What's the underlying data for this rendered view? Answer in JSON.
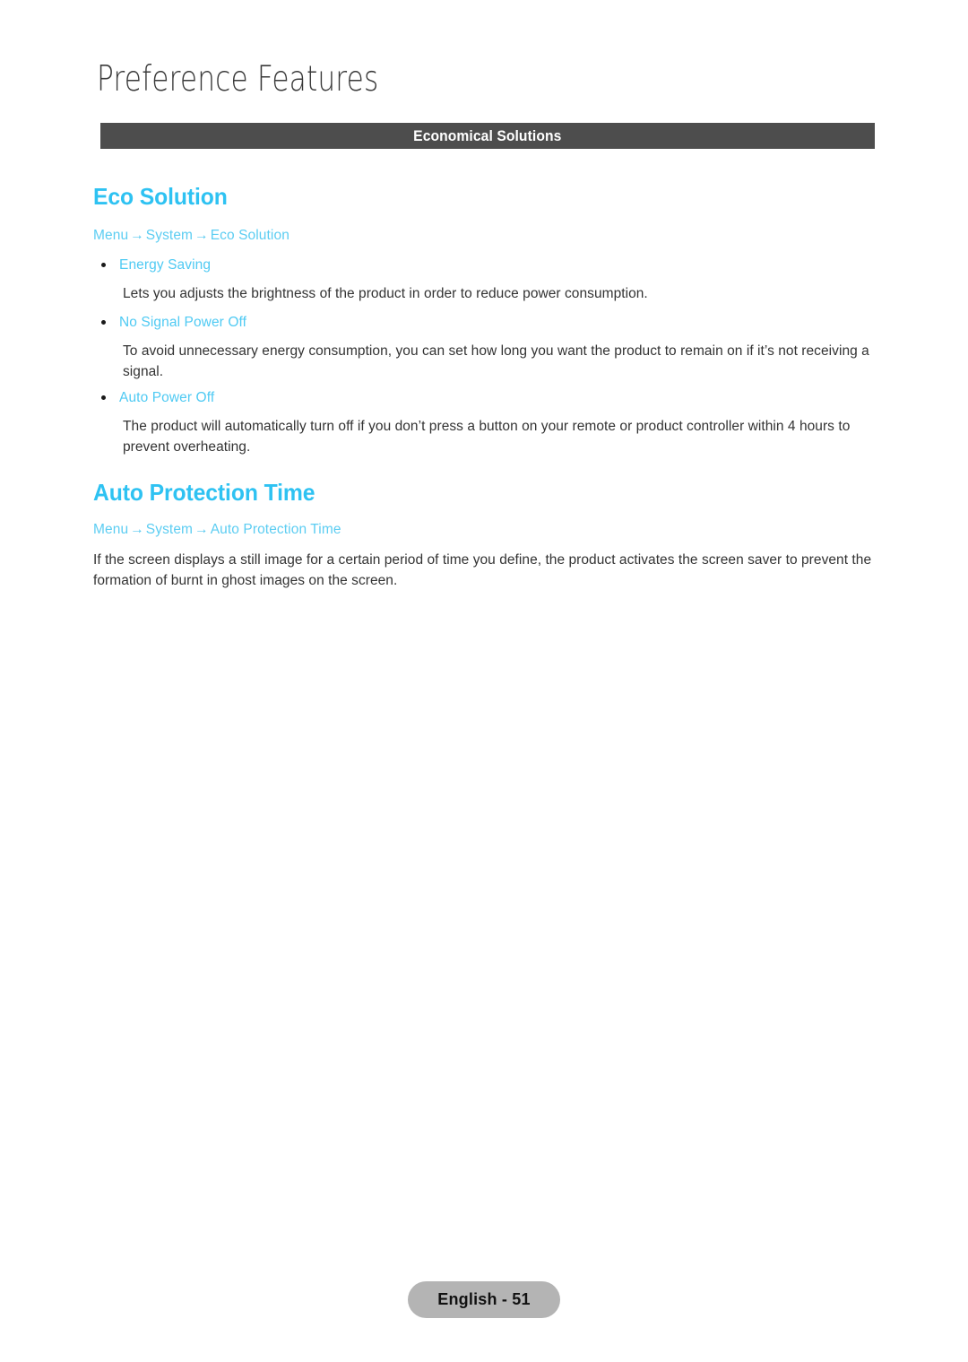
{
  "page": {
    "chapter_title": "Preference Features",
    "section_banner_label": "Economical Solutions",
    "footer_label": "English - 51",
    "colors": {
      "heading_cyan": "#2ec2f2",
      "link_cyan": "#5ccdf2",
      "bullet_cyan": "#4fcaf3",
      "banner_gray": "#4d4d4d",
      "footer_gray": "#b4b4b4",
      "body_text": "#333333",
      "title_gray": "#3a3a3a"
    }
  },
  "sections": [
    {
      "heading": "Eco Solution",
      "breadcrumb": {
        "part1": "Menu",
        "arrow1": "→",
        "part2": "System",
        "arrow2": "→",
        "part3": "Eco Solution"
      },
      "items": [
        {
          "label": "Energy Saving",
          "description": "Lets you adjusts the brightness of the product in order to reduce power consumption."
        },
        {
          "label": "No Signal Power Off",
          "description": "To avoid unnecessary energy consumption, you can set how long you want the product to remain on if it’s not receiving a signal."
        },
        {
          "label": "Auto Power Off",
          "description": "The product will automatically turn off if you don’t press a button on your remote or product controller within 4 hours to prevent overheating."
        }
      ]
    },
    {
      "heading": "Auto Protection Time",
      "breadcrumb": {
        "part1": "Menu",
        "arrow1": "→",
        "part2": "System",
        "arrow2": "→",
        "part3": "Auto Protection Time"
      },
      "body": "If the screen displays a still image for a certain period of time you define, the product activates the screen saver to prevent the formation of burnt in ghost images on the screen."
    }
  ]
}
